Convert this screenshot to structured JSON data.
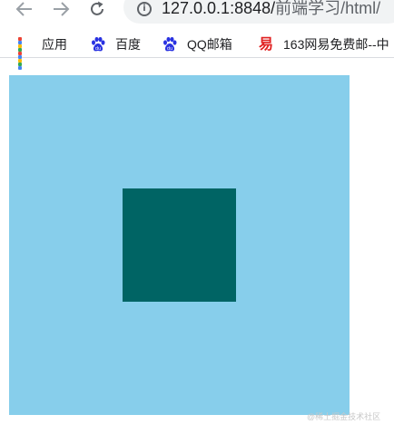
{
  "browser": {
    "url_host": "127.0.0.1:8848/",
    "url_path": "前端学习/html/"
  },
  "bookmarks": [
    {
      "label": "应用",
      "icon": "apps-grid-icon"
    },
    {
      "label": "百度",
      "icon": "baidu-paw-icon"
    },
    {
      "label": "QQ邮箱",
      "icon": "baidu-paw-icon"
    },
    {
      "label": "163网易免费邮--中",
      "icon": "netease-icon"
    }
  ],
  "page": {
    "outer_box_color": "#87ceeb",
    "inner_box_color": "#006464"
  },
  "watermark": "@稀土掘金技术社区"
}
